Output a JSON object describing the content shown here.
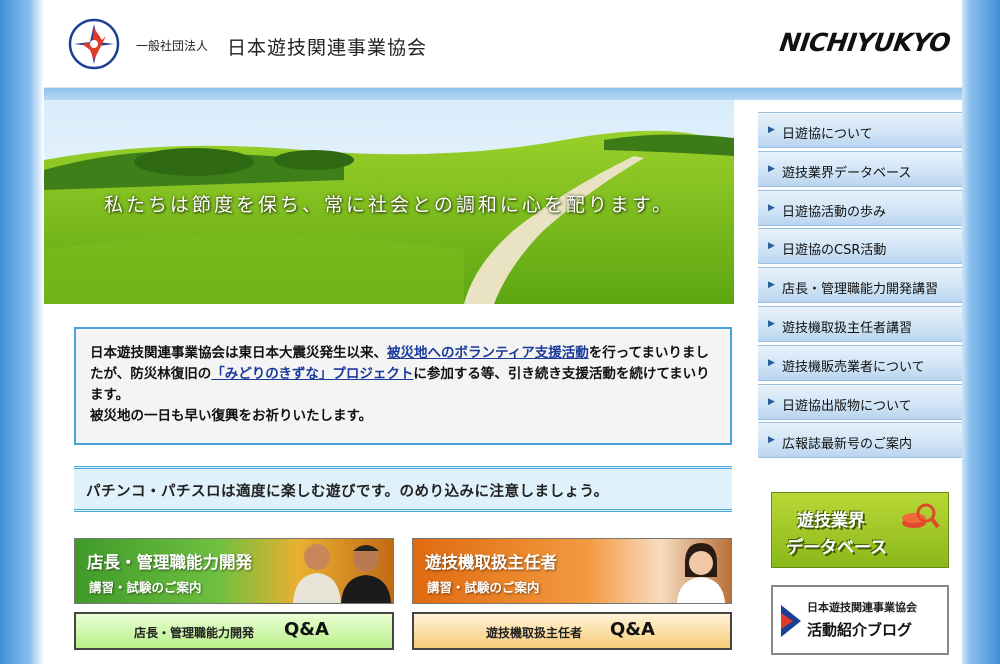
{
  "header": {
    "org_prefix": "一般社団法人",
    "org_name": "日本遊技関連事業協会",
    "brand": "NICHIYUKYO"
  },
  "hero": {
    "slogan": "私たちは節度を保ち、常に社会との調和に心を配ります。"
  },
  "notice": {
    "part1": "日本遊技関連事業協会は東日本大震災発生以来、",
    "link1": "被災地へのボランティア支援活動",
    "part2": "を行ってまいりましたが、防災林復旧の",
    "link2": "「みどりのきずな」プロジェクト",
    "part3": "に参加する等、引き続き支援活動を続けてまいります。",
    "line2": "被災地の一日も早い復興をお祈りいたします。"
  },
  "pachinko_message": "パチンコ・パチスロは適度に楽しむ遊びです。のめり込みに注意しましょう。",
  "banners": {
    "manager": {
      "title": "店長・管理職能力開発",
      "sub": "講習・試験のご案内"
    },
    "chief": {
      "title": "遊技機取扱主任者",
      "sub": "講習・試験のご案内"
    }
  },
  "qa": {
    "manager": {
      "label": "店長・管理職能力開発",
      "q": "Q&A"
    },
    "chief": {
      "label": "遊技機取扱主任者",
      "q": "Q&A"
    }
  },
  "sidebar": {
    "items": [
      {
        "label": "日遊協について"
      },
      {
        "label": "遊技業界データベース"
      },
      {
        "label": "日遊協活動の歩み"
      },
      {
        "label": "日遊協のCSR活動"
      },
      {
        "label": "店長・管理職能力開発講習"
      },
      {
        "label": "遊技機取扱主任者講習"
      },
      {
        "label": "遊技機販売業者について"
      },
      {
        "label": "日遊協出版物について"
      },
      {
        "label": "広報誌最新号のご案内"
      }
    ],
    "arrow": "▶"
  },
  "side_banners": {
    "database": {
      "line1": "遊技業界",
      "line2": "データベース"
    },
    "blog": {
      "line1": "日本遊技関連事業協会",
      "line2": "活動紹介ブログ"
    }
  },
  "colors": {
    "accent_blue": "#4aa3d8",
    "link": "#1a3a9a",
    "logo_red": "#e23a2a",
    "logo_blue": "#1c3f96"
  }
}
